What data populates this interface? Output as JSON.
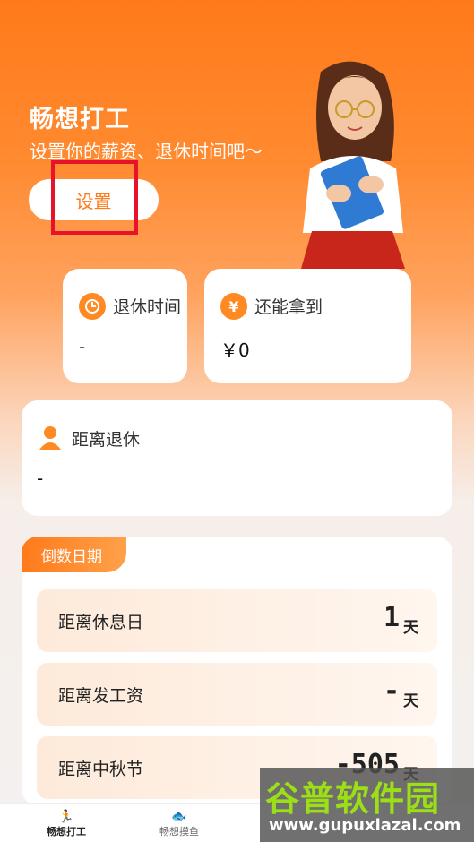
{
  "hero": {
    "title": "畅想打工",
    "subtitle": "设置你的薪资、退休时间吧～",
    "set_button": "设置"
  },
  "cards": {
    "retire_time": {
      "label": "退休时间",
      "value": "-",
      "icon": "clock-icon"
    },
    "can_earn": {
      "label": "还能拿到",
      "value": "￥0",
      "icon": "yen-icon",
      "icon_glyph": "¥"
    }
  },
  "distance_retire": {
    "label": "距离退休",
    "value": "-",
    "icon": "person-icon"
  },
  "countdown": {
    "badge": "倒数日期",
    "rows": [
      {
        "label": "距离休息日",
        "value": "1",
        "unit": "天"
      },
      {
        "label": "距离发工资",
        "value": "-",
        "unit": "天"
      },
      {
        "label": "距离中秋节",
        "value": "-505",
        "unit": "天"
      }
    ]
  },
  "tabbar": {
    "tabs": [
      {
        "label": "畅想打工",
        "icon": "running-icon",
        "glyph": "🏃",
        "active": true
      },
      {
        "label": "畅想摸鱼",
        "icon": "fish-icon",
        "glyph": "🐟",
        "active": false
      }
    ]
  },
  "watermark": {
    "title": "谷普软件园",
    "url": "www.gupuxiazai.com"
  },
  "colors": {
    "accent": "#ff7a1a",
    "highlight_box": "#e8132b",
    "watermark_green": "#9be016"
  }
}
